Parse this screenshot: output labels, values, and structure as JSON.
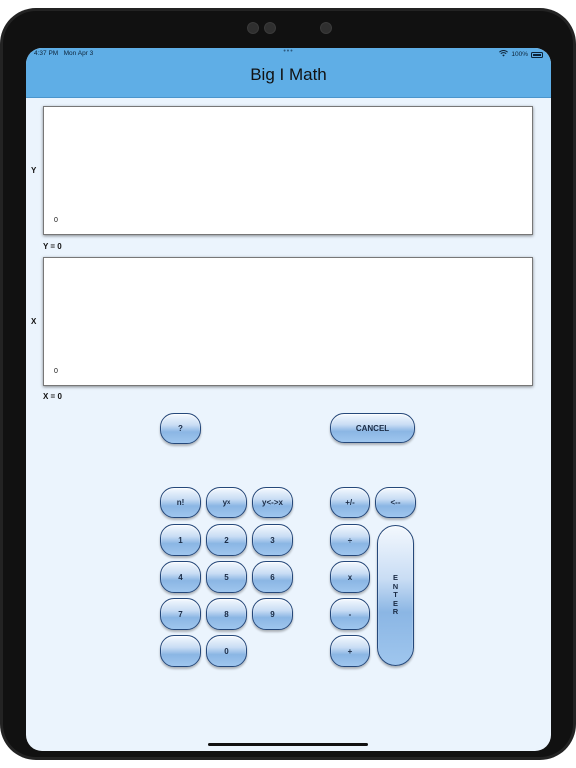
{
  "status_bar": {
    "time": "4:37 PM",
    "date": "Mon Apr 3",
    "battery": "100%"
  },
  "app": {
    "title": "Big I Math"
  },
  "registers": {
    "y": {
      "label": "Y",
      "value": "0",
      "summary": "Y = 0"
    },
    "x": {
      "label": "X",
      "value": "0",
      "summary": "X = 0"
    }
  },
  "keys": {
    "help": "?",
    "cancel": "CANCEL",
    "factorial": "n!",
    "power_base": "y",
    "power_exp": "x",
    "swap": "y<->x",
    "sign": "+/-",
    "backspace": "<--",
    "d1": "1",
    "d2": "2",
    "d3": "3",
    "d4": "4",
    "d5": "5",
    "d6": "6",
    "d7": "7",
    "d8": "8",
    "d9": "9",
    "d0": "0",
    "blank": "",
    "divide": "÷",
    "multiply": "x",
    "subtract": "-",
    "add": "+",
    "enter_letters": [
      "E",
      "N",
      "T",
      "E",
      "R"
    ]
  }
}
